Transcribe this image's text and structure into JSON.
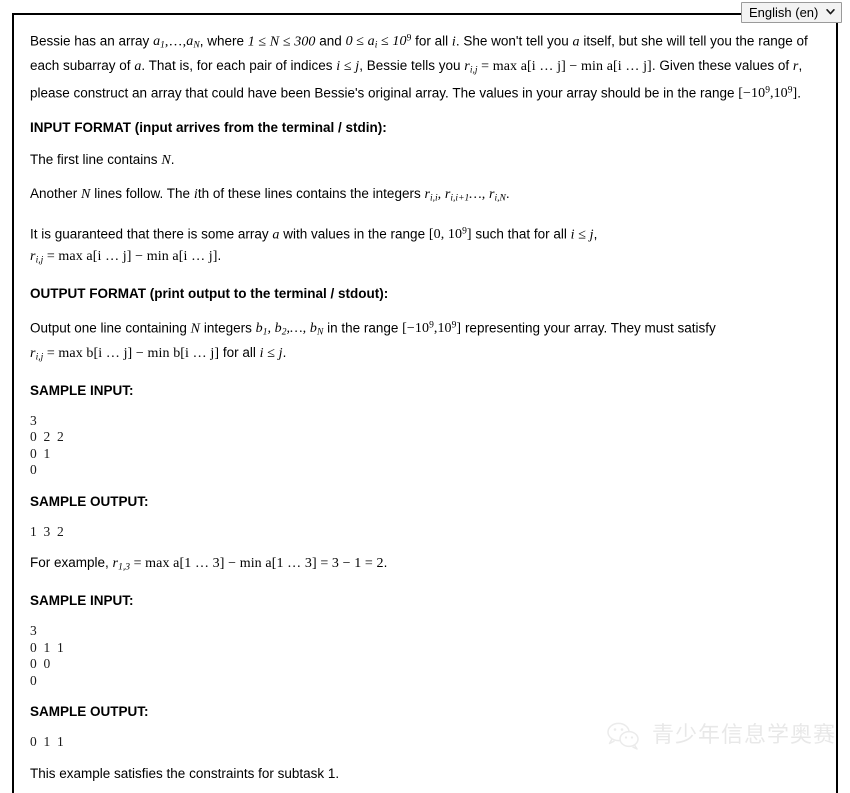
{
  "language_selector": {
    "selected": "English (en)",
    "options": [
      "English (en)"
    ],
    "chevron_icon": "chevron-down-icon"
  },
  "statement": {
    "intro": {
      "t1": "Bessie has an array ",
      "m1": "a",
      "m1s": "1",
      "t2": ",…,",
      "m2": "a",
      "m2s": "N",
      "t3": ", where ",
      "m3": "1 ≤ N ≤ 300",
      "t4": " and ",
      "m4": "0 ≤ a",
      "m4s": "i",
      "m4b": " ≤ 10",
      "m4e": "9",
      "t5": " for all ",
      "m5": "i",
      "t6": ". She won't tell you ",
      "m6": "a",
      "t7": " itself, but she will tell you the range of each subarray of ",
      "m7": "a",
      "t8": ". That is, for each pair of indices ",
      "m8": "i ≤ j",
      "t9": ", Bessie tells you ",
      "m9": "r",
      "m9s": "i,j",
      "m9b": " = max a[i … j] − min a[i … j]",
      "t10": ". Given these values of ",
      "m10": "r",
      "t11": ", please construct an array that could have been Bessie's original array. The values in your array should be in the range ",
      "m11": "[−10",
      "m11e": "9",
      "m11b": ",10",
      "m11e2": "9",
      "m11c": "]",
      "t12": "."
    },
    "input_format_heading": "INPUT FORMAT (input arrives from the terminal / stdin):",
    "input_p1_a": "The first line contains ",
    "input_p1_m": "N",
    "input_p1_b": ".",
    "input_p2_a": "Another ",
    "input_p2_m1": "N",
    "input_p2_b": " lines follow. The ",
    "input_p2_m2": "i",
    "input_p2_c": "th of these lines contains the integers ",
    "input_p2_m3": "r",
    "input_p2_m3s": "i,i",
    "input_p2_m4": ", r",
    "input_p2_m4s": "i,i+1",
    "input_p2_m5": "…, r",
    "input_p2_m5s": "i,N",
    "input_p2_d": ".",
    "input_p3_a": "It is guaranteed that there is some array ",
    "input_p3_m1": "a",
    "input_p3_b": " with values in the range ",
    "input_p3_m2": "[0, 10",
    "input_p3_m2e": "9",
    "input_p3_m2b": "]",
    "input_p3_c": " such that for all ",
    "input_p3_m3": "i ≤ j",
    "input_p3_d": ", ",
    "input_p3_m4": "r",
    "input_p3_m4s": "i,j",
    "input_p3_m5": " = max a[i … j] − min a[i … j]",
    "input_p3_e": ".",
    "output_format_heading": "OUTPUT FORMAT (print output to the terminal / stdout):",
    "output_p_a": "Output one line containing ",
    "output_p_m1": "N",
    "output_p_b": " integers ",
    "output_p_m2": "b",
    "output_p_m2s": "1",
    "output_p_m3": ", b",
    "output_p_m3s": "2",
    "output_p_m4": ",…, b",
    "output_p_m4s": "N",
    "output_p_c": " in the range ",
    "output_p_m5": "[−10",
    "output_p_m5e": "9",
    "output_p_m5b": ",10",
    "output_p_m5e2": "9",
    "output_p_m5c": "]",
    "output_p_d": " representing your array. They must satisfy ",
    "output_p_m6": "r",
    "output_p_m6s": "i,j",
    "output_p_m7": " = max b[i … j] − min b[i … j]",
    "output_p_e": " for all ",
    "output_p_m8": "i ≤ j",
    "output_p_f": ".",
    "sample_input_heading_1": "SAMPLE INPUT:",
    "sample_input_1": "3\n0  2  2\n0  1\n0",
    "sample_output_heading_1": "SAMPLE OUTPUT:",
    "sample_output_1": "1  3  2",
    "explanation_a": "For example, ",
    "explanation_m1": "r",
    "explanation_m1s": "1,3",
    "explanation_m2": " = max a[1 … 3] − min a[1 … 3] = 3 − 1 = 2",
    "explanation_b": ".",
    "sample_input_heading_2": "SAMPLE INPUT:",
    "sample_input_2": "3\n0  1  1\n0  0\n0",
    "sample_output_heading_2": "SAMPLE OUTPUT:",
    "sample_output_2": "0  1  1",
    "subtask_note": "This example satisfies the constraints for subtask 1."
  },
  "watermark": {
    "text": "青少年信息学奥赛",
    "icon": "wechat-icon",
    "color": "#d2d2d2"
  }
}
